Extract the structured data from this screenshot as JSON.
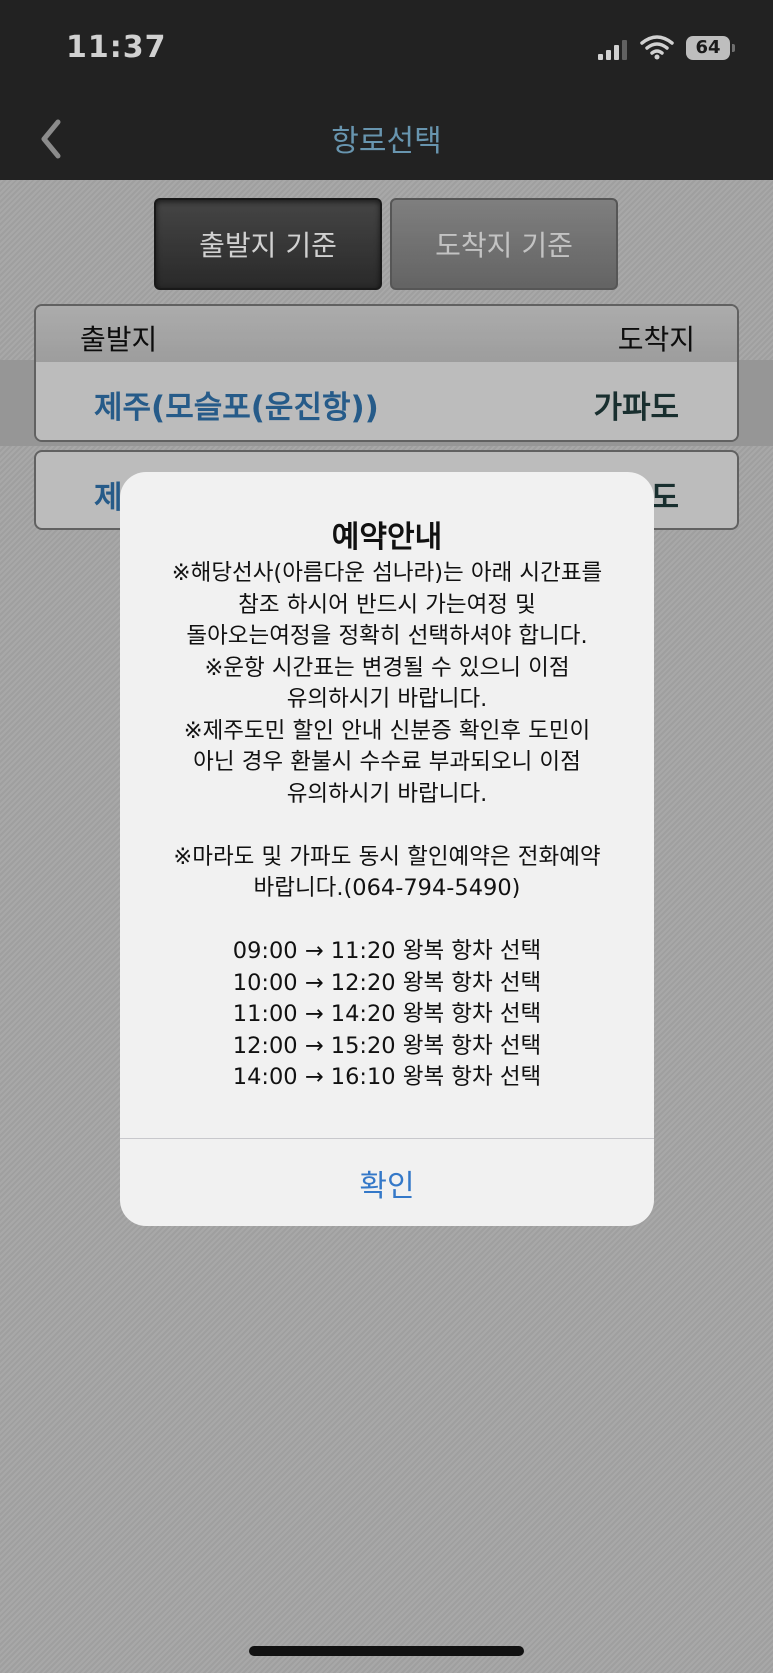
{
  "status_bar": {
    "time": "11:37",
    "battery": "64"
  },
  "nav": {
    "title": "항로선택"
  },
  "segments": {
    "departure": "출발지 기준",
    "arrival": "도착지 기준"
  },
  "table": {
    "header": {
      "departure": "출발지",
      "arrival": "도착지"
    },
    "rows": [
      {
        "departure": "제주(모슬포(운진항))",
        "arrival": "가파도"
      },
      {
        "departure": "제",
        "arrival": "도"
      }
    ]
  },
  "alert": {
    "title": "예약안내",
    "lines": [
      "※해당선사(아름다운 섬나라)는 아래 시간표를",
      "참조 하시어 반드시 가는여정 및",
      "돌아오는여정을 정확히 선택하셔야 합니다.",
      "※운항 시간표는 변경될 수 있으니 이점",
      "유의하시기 바랍니다.",
      "※제주도민 할인 안내 신분증 확인후 도민이",
      "아닌 경우 환불시 수수료 부과되오니 이점",
      "유의하시기 바랍니다.",
      "",
      "※마라도 및 가파도 동시 할인예약은 전화예약",
      "바랍니다.(064-794-5490)",
      "",
      "09:00  → 11:20 왕복 항차 선택",
      "10:00  → 12:20 왕복 항차 선택",
      "11:00  → 14:20 왕복 항차 선택",
      "12:00  → 15:20 왕복 항차 선택",
      "14:00  → 16:10 왕복 항차 선택"
    ],
    "confirm": "확인"
  },
  "colors": {
    "link_blue": "#2f6fa8",
    "alert_button": "#3478c8",
    "nav_title": "#7fb6d6",
    "dark_bar": "#2a2a2a"
  },
  "icons": {
    "back": "chevron-left-icon",
    "signal": "cellular-signal-icon",
    "wifi": "wifi-icon",
    "battery": "battery-icon"
  }
}
